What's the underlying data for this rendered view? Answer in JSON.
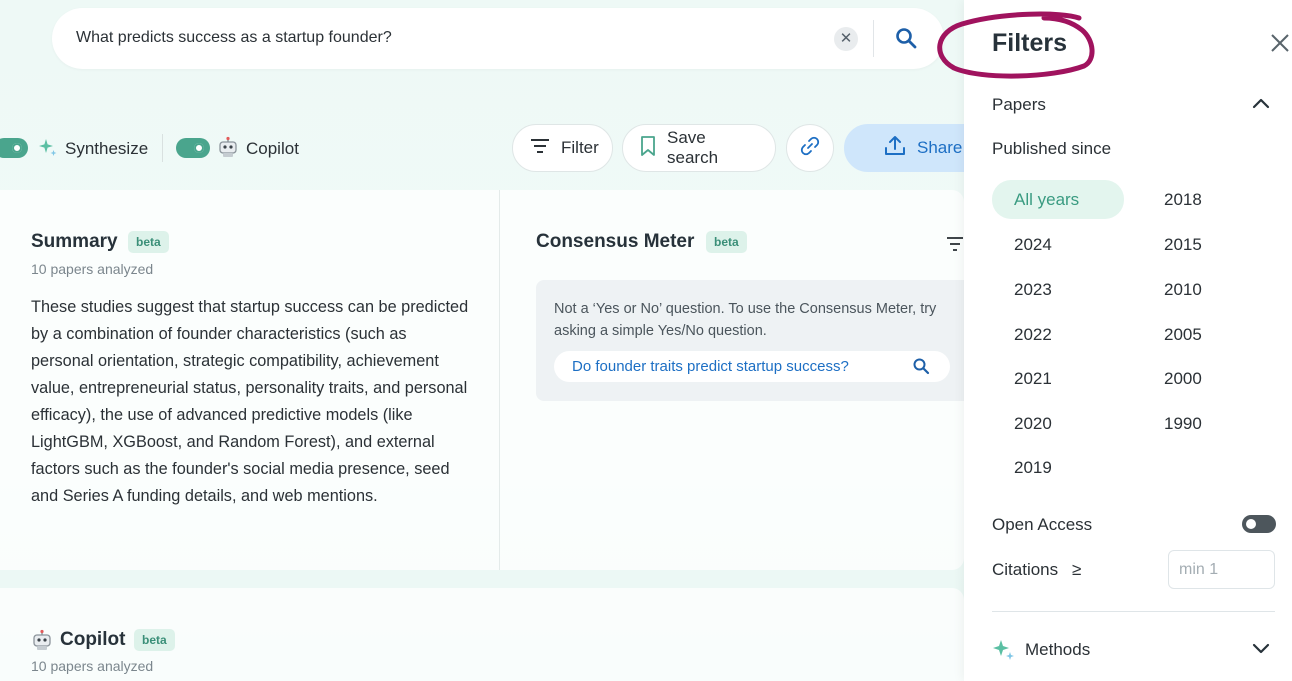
{
  "search": {
    "query": "What predicts success as a startup founder?"
  },
  "toolbar": {
    "synthesize_label": "Synthesize",
    "copilot_label": "Copilot",
    "filter_label": "Filter",
    "save_search_label": "Save search",
    "share_label": "Share"
  },
  "summary": {
    "title": "Summary",
    "badge": "beta",
    "papers_analyzed": "10 papers analyzed",
    "body": "These studies suggest that startup success can be predicted by a combination of founder characteristics (such as personal orientation, strategic compatibility, achievement value, entrepreneurial status, personality traits, and personal efficacy), the use of advanced predictive models (like LightGBM, XGBoost, and Random Forest), and external factors such as the founder's social media presence, seed and Series A funding details, and web mentions."
  },
  "consensus_meter": {
    "title": "Consensus Meter",
    "badge": "beta",
    "note": "Not a ‘Yes or No’ question. To use the Consensus Meter, try asking a simple Yes/No question.",
    "suggestion": "Do founder traits predict startup success?"
  },
  "copilot": {
    "title": "Copilot",
    "badge": "beta",
    "papers_analyzed": "10 papers analyzed"
  },
  "filters": {
    "title": "Filters",
    "papers_label": "Papers",
    "published_since_label": "Published since",
    "years_left": [
      "All years",
      "2024",
      "2023",
      "2022",
      "2021",
      "2020",
      "2019"
    ],
    "years_right": [
      "2018",
      "2015",
      "2010",
      "2005",
      "2000",
      "1990"
    ],
    "selected_year": "All years",
    "open_access_label": "Open Access",
    "open_access_enabled": false,
    "citations_label": "Citations",
    "citations_operator": "≥",
    "citations_placeholder": "min 1",
    "methods_label": "Methods"
  },
  "colors": {
    "accent": "#4aa58d",
    "link": "#1d6fc4",
    "annotation": "#a0135e"
  },
  "icons": [
    "search-icon",
    "clear-icon",
    "sparkle-icon",
    "robot-icon",
    "filter-lines-icon",
    "bookmark-icon",
    "link-icon",
    "upload-icon",
    "close-icon",
    "chevron-up-icon",
    "chevron-down-icon"
  ]
}
